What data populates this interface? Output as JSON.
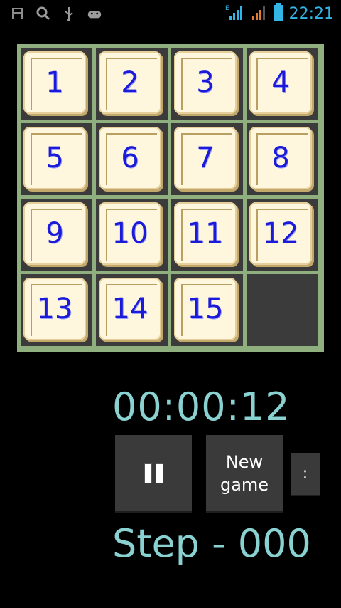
{
  "status_bar": {
    "icons_left": [
      "save-icon",
      "search-icon",
      "usb-icon",
      "android-icon"
    ],
    "network_label": "E",
    "time": "22:21",
    "accent": "#33b5e5"
  },
  "board": {
    "tiles": [
      "1",
      "2",
      "3",
      "4",
      "5",
      "6",
      "7",
      "8",
      "9",
      "10",
      "11",
      "12",
      "13",
      "14",
      "15",
      ""
    ],
    "tile_color": "#fff7dd",
    "number_color": "#1a1ad8",
    "grid_color": "#8fb07e",
    "empty_color": "#3b3b3b"
  },
  "timer": "00:00:12",
  "controls": {
    "pause_icon": "pause-icon",
    "new_game_line1": "New",
    "new_game_line2": "game",
    "more_label": ":"
  },
  "step": "Step - 000",
  "text_color": "#8ad1d1"
}
